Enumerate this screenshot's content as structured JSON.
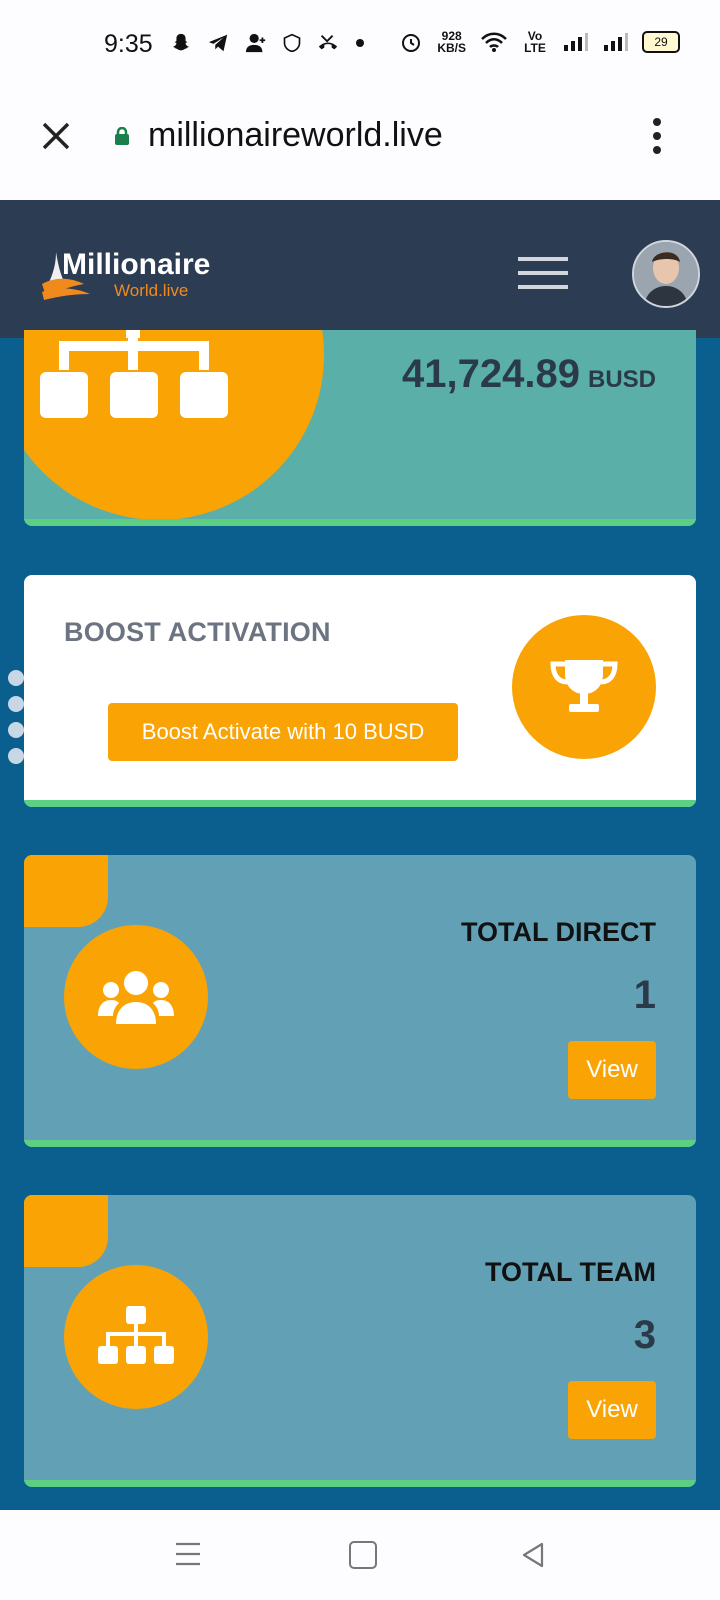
{
  "status_bar": {
    "time": "9:35",
    "net_speed_value": "928",
    "net_speed_unit": "KB/S",
    "volte": "Vo LTE",
    "battery": "29",
    "icons": [
      "snapchat-icon",
      "telegram-icon",
      "add-user-icon",
      "shield-icon",
      "missed-call-icon",
      "dot-icon",
      "alarm-icon",
      "wifi-icon",
      "signal-icon",
      "signal-icon-2",
      "battery-icon"
    ]
  },
  "browser": {
    "url": "millionaireworld.live",
    "close_icon": "close-icon",
    "lock_icon": "lock-icon",
    "menu_icon": "kebab-menu-icon"
  },
  "header": {
    "logo_line1": "Millionaire",
    "logo_line2": "World.live",
    "menu_icon": "hamburger-icon",
    "avatar": "user-avatar"
  },
  "cards": {
    "earnings": {
      "amount": "41,724.89",
      "unit": "BUSD",
      "icon": "hierarchy-icon"
    },
    "boost": {
      "title": "BOOST ACTIVATION",
      "button_label": "Boost Activate with 10 BUSD",
      "icon": "trophy-icon"
    },
    "total_direct": {
      "label": "TOTAL DIRECT",
      "value": "1",
      "button_label": "View",
      "icon": "users-icon"
    },
    "total_team": {
      "label": "TOTAL TEAM",
      "value": "3",
      "button_label": "View",
      "icon": "hierarchy-icon"
    }
  },
  "colors": {
    "page_bg": "#0b5f8e",
    "header_bg": "#2c3c52",
    "accent_orange": "#f9a404",
    "teal_card": "#5aafa8",
    "blue_card": "#62a1b5",
    "bottom_line": "#5dcf83"
  },
  "nav_bar": {
    "icons": [
      "recent-apps-icon",
      "home-icon",
      "back-icon"
    ]
  }
}
